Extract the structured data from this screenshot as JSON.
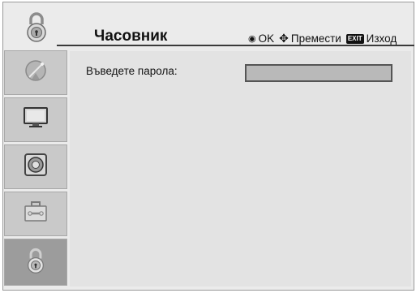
{
  "header": {
    "title": "Часовник",
    "hints": {
      "ok_symbol": "◉",
      "ok_label": "OK",
      "move_symbol": "✥",
      "move_label": "Премести",
      "exit_badge": "EXIT",
      "exit_label": "Изход"
    }
  },
  "sidebar": {
    "items": [
      {
        "icon": "satellite-dish-icon",
        "active": false
      },
      {
        "icon": "tv-monitor-icon",
        "active": false
      },
      {
        "icon": "speaker-icon",
        "active": false
      },
      {
        "icon": "toolbox-icon",
        "active": false
      },
      {
        "icon": "padlock-icon",
        "active": true
      }
    ]
  },
  "main": {
    "prompt_label": "Въведете парола:",
    "password_value": ""
  },
  "colors": {
    "background": "#ebebeb",
    "sidebar_item": "#c9c9c9",
    "sidebar_active": "#9c9c9c",
    "password_field": "#b9b9b9"
  }
}
